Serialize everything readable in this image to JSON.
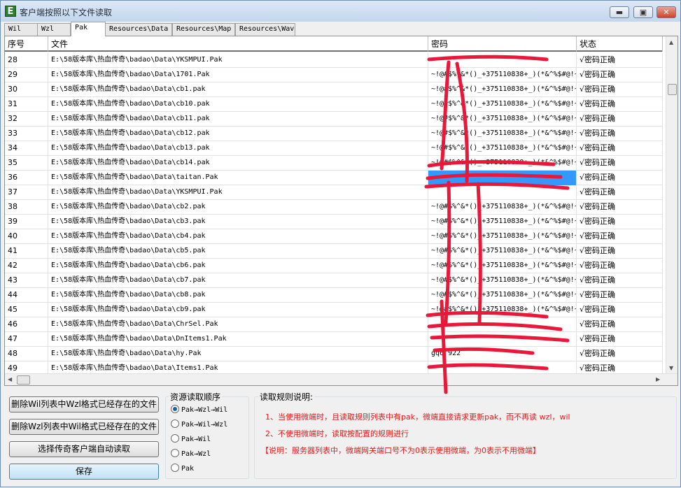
{
  "window": {
    "title": "客户端按照以下文件读取",
    "icon_letter": "E",
    "min_label": "▬",
    "max_label": "▣",
    "close_label": "✕"
  },
  "tabs": [
    {
      "label": "Wil",
      "active": false
    },
    {
      "label": "Wzl",
      "active": false
    },
    {
      "label": "Pak",
      "active": true
    },
    {
      "label": "Resources\\Data",
      "active": false
    },
    {
      "label": "Resources\\Map",
      "active": false
    },
    {
      "label": "Resources\\Wav",
      "active": false
    }
  ],
  "table": {
    "columns": [
      "序号",
      "文件",
      "密码",
      "状态"
    ],
    "rows": [
      {
        "no": "28",
        "file": "E:\\58版本库\\热血传奇\\badao\\Data\\YKSMPUI.Pak",
        "password": "",
        "status": "√密码正确"
      },
      {
        "no": "29",
        "file": "E:\\58版本库\\热血传奇\\badao\\Data\\1701.Pak",
        "password": "~!@#$%^&*()_+375110838+_)(*&^%$#@!~",
        "status": "√密码正确"
      },
      {
        "no": "30",
        "file": "E:\\58版本库\\热血传奇\\badao\\Data\\cb1.pak",
        "password": "~!@#$%^&*()_+375110838+_)(*&^%$#@!~",
        "status": "√密码正确"
      },
      {
        "no": "31",
        "file": "E:\\58版本库\\热血传奇\\badao\\Data\\cb10.pak",
        "password": "~!@#$%^&*()_+375110838+_)(*&^%$#@!~",
        "status": "√密码正确"
      },
      {
        "no": "32",
        "file": "E:\\58版本库\\热血传奇\\badao\\Data\\cb11.pak",
        "password": "~!@#$%^&*()_+375110838+_)(*&^%$#@!~",
        "status": "√密码正确"
      },
      {
        "no": "33",
        "file": "E:\\58版本库\\热血传奇\\badao\\Data\\cb12.pak",
        "password": "~!@#$%^&*()_+375110838+_)(*&^%$#@!~",
        "status": "√密码正确"
      },
      {
        "no": "34",
        "file": "E:\\58版本库\\热血传奇\\badao\\Data\\cb13.pak",
        "password": "~!@#$%^&*()_+375110838+_)(*&^%$#@!~",
        "status": "√密码正确"
      },
      {
        "no": "35",
        "file": "E:\\58版本库\\热血传奇\\badao\\Data\\cb14.pak",
        "password": "~!@#$%^&*()_+375110838+_)(*&^%$#@!~",
        "status": "√密码正确"
      },
      {
        "no": "36",
        "file": "E:\\58版本库\\热血传奇\\badao\\Data\\taitan.Pak",
        "password": "",
        "status": "√密码正确",
        "selected": true
      },
      {
        "no": "37",
        "file": "E:\\58版本库\\热血传奇\\badao\\Data\\YKSMPUI.Pak",
        "password": "",
        "status": "√密码正确"
      },
      {
        "no": "38",
        "file": "E:\\58版本库\\热血传奇\\badao\\Data\\cb2.pak",
        "password": "~!@#$%^&*()_+375110838+_)(*&^%$#@!~",
        "status": "√密码正确"
      },
      {
        "no": "39",
        "file": "E:\\58版本库\\热血传奇\\badao\\Data\\cb3.pak",
        "password": "~!@#$%^&*()_+375110838+_)(*&^%$#@!~",
        "status": "√密码正确"
      },
      {
        "no": "40",
        "file": "E:\\58版本库\\热血传奇\\badao\\Data\\cb4.pak",
        "password": "~!@#$%^&*()_+375110838+_)(*&^%$#@!~",
        "status": "√密码正确"
      },
      {
        "no": "41",
        "file": "E:\\58版本库\\热血传奇\\badao\\Data\\cb5.pak",
        "password": "~!@#$%^&*()_+375110838+_)(*&^%$#@!~",
        "status": "√密码正确"
      },
      {
        "no": "42",
        "file": "E:\\58版本库\\热血传奇\\badao\\Data\\cb6.pak",
        "password": "~!@#$%^&*()_+375110838+_)(*&^%$#@!~",
        "status": "√密码正确"
      },
      {
        "no": "43",
        "file": "E:\\58版本库\\热血传奇\\badao\\Data\\cb7.pak",
        "password": "~!@#$%^&*()_+375110838+_)(*&^%$#@!~",
        "status": "√密码正确"
      },
      {
        "no": "44",
        "file": "E:\\58版本库\\热血传奇\\badao\\Data\\cb8.pak",
        "password": "~!@#$%^&*()_+375110838+_)(*&^%$#@!~",
        "status": "√密码正确"
      },
      {
        "no": "45",
        "file": "E:\\58版本库\\热血传奇\\badao\\Data\\cb9.pak",
        "password": "~!@#$%^&*()_+375110838+_)(*&^%$#@!~",
        "status": "√密码正确"
      },
      {
        "no": "46",
        "file": "E:\\58版本库\\热血传奇\\badao\\Data\\ChrSel.Pak",
        "password": "",
        "status": "√密码正确"
      },
      {
        "no": "47",
        "file": "E:\\58版本库\\热血传奇\\badao\\Data\\DnItems1.Pak",
        "password": "",
        "status": "√密码正确"
      },
      {
        "no": "48",
        "file": "E:\\58版本库\\热血传奇\\badao\\Data\\hy.Pak",
        "password": "gq6 922",
        "status": "√密码正确"
      },
      {
        "no": "49",
        "file": "E:\\58版本库\\热血传奇\\badao\\Data\\Items1.Pak",
        "password": "",
        "status": "√密码正确"
      }
    ]
  },
  "buttons": {
    "delete_wil": "删除Wil列表中Wzl格式已经存在的文件",
    "delete_wzl": "删除Wzl列表中Wil格式已经存在的文件",
    "auto_read": "选择传奇客户端自动读取",
    "save": "保存"
  },
  "order_group": {
    "title": "资源读取顺序",
    "options": [
      {
        "label": "Pak→Wzl→Wil",
        "checked": true
      },
      {
        "label": "Pak→Wil→Wzl",
        "checked": false
      },
      {
        "label": "Pak→Wil",
        "checked": false
      },
      {
        "label": "Pak→Wzl",
        "checked": false
      },
      {
        "label": "Pak",
        "checked": false
      }
    ]
  },
  "rules_group": {
    "title": "读取规则说明:",
    "lines": [
      "1、当使用微端时，且读取规则列表中有pak，微端直接请求更新pak，而不再读 wzl，wil",
      "2、不使用微端时，读取按配置的规则进行",
      "【说明：服务器列表中，微端网关端口号不为0表示使用微端，为0表示不用微端】"
    ]
  },
  "colors": {
    "annotation_red": "#e8183a",
    "selection_blue": "#3399ff",
    "rule_text_red": "#e31a1a"
  }
}
